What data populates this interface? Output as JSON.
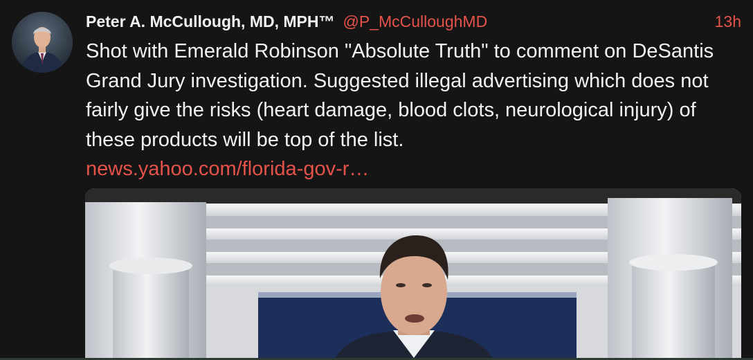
{
  "tweet": {
    "author_name": "Peter A. McCullough, MD, MPH™",
    "handle": "@P_McCulloughMD",
    "time_ago": "13h",
    "text": "Shot with Emerald Robinson \"Absolute Truth\" to comment on DeSantis Grand Jury investigation.  Suggested illegal advertising which does not fairly give the risks (heart damage, blood clots, neurological injury) of these products will be top of the list.",
    "link_text": "news.yahoo.com/florida-gov-r…"
  },
  "colors": {
    "background": "#151515",
    "text": "#f2f2f2",
    "accent": "#e5524a"
  }
}
